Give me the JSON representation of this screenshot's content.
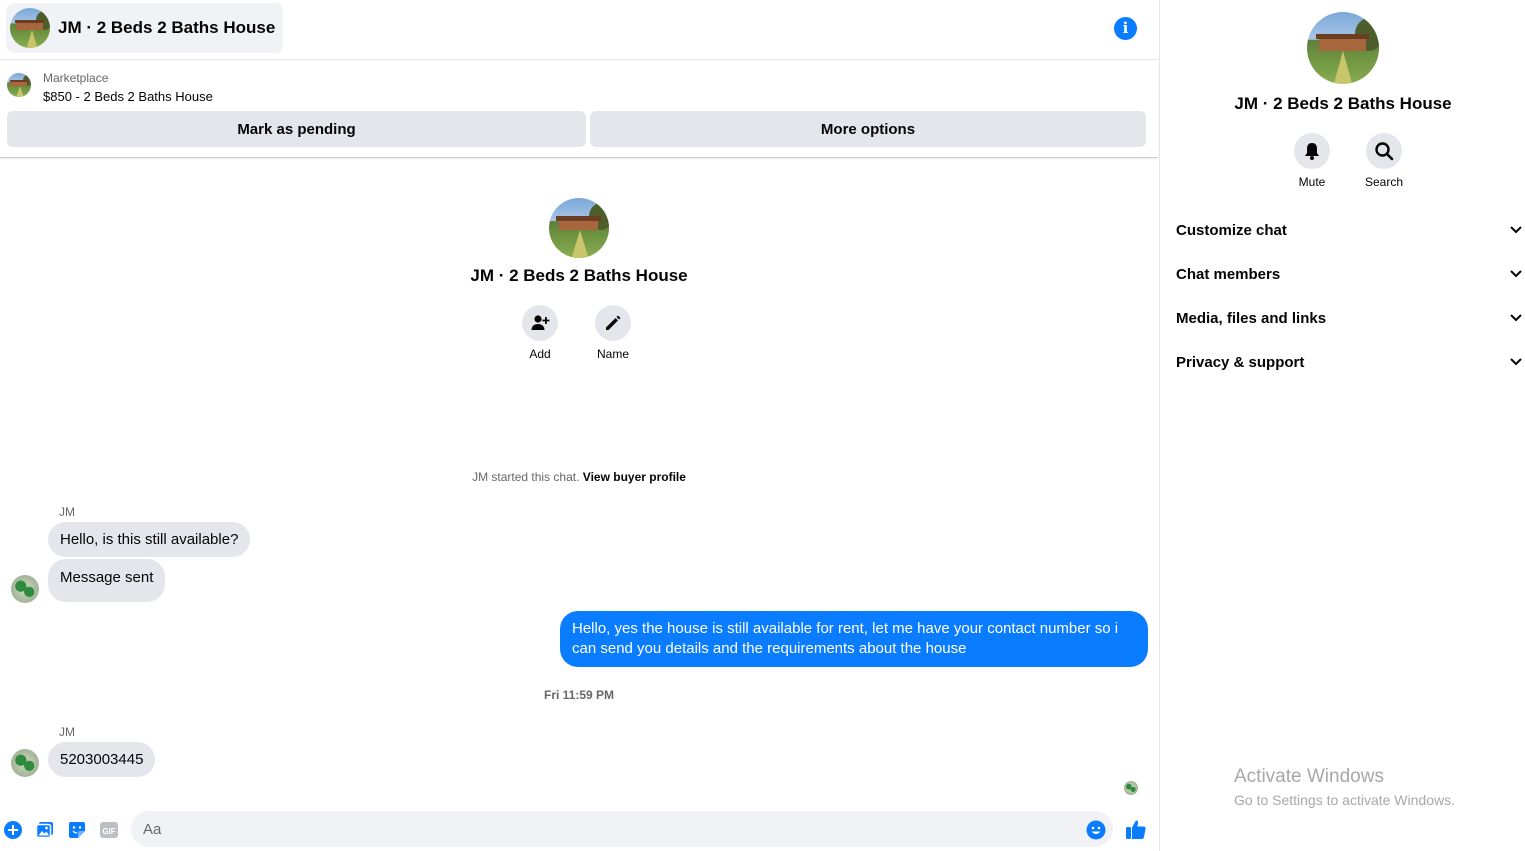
{
  "header": {
    "title": "JM · 2 Beds 2 Baths House"
  },
  "marketplace": {
    "label": "Marketplace",
    "listing": "$850 - 2 Beds 2 Baths House",
    "mark_pending": "Mark as pending",
    "more_options": "More options"
  },
  "chat_intro": {
    "name": "JM · 2 Beds 2 Baths House",
    "add_label": "Add",
    "name_label": "Name",
    "started_text": "JM started this chat.",
    "view_profile": "View buyer profile"
  },
  "messages": [
    {
      "sender": "JM",
      "text": "Hello, is this still available?",
      "direction": "in"
    },
    {
      "text": "Message sent",
      "direction": "in"
    },
    {
      "text": "Hello, yes the house is still available for rent, let me have your contact number so i can send you details and the requirements about the house",
      "direction": "out"
    },
    {
      "sender": "JM",
      "text": "5203003445",
      "direction": "in"
    }
  ],
  "timestamp": "Fri 11:59 PM",
  "composer": {
    "placeholder": "Aa"
  },
  "side_panel": {
    "name": "JM · 2 Beds 2 Baths House",
    "mute_label": "Mute",
    "search_label": "Search",
    "sections": [
      "Customize chat",
      "Chat members",
      "Media, files and links",
      "Privacy & support"
    ]
  },
  "watermark": {
    "title": "Activate Windows",
    "subtitle": "Go to Settings to activate Windows."
  },
  "colors": {
    "accent": "#0a7cff",
    "bubble_in": "#e4e6eb",
    "muted_text": "#65676b"
  },
  "icons": [
    "info-icon",
    "add-person-icon",
    "pencil-icon",
    "bell-icon",
    "search-icon",
    "chevron-down-icon",
    "plus-circle-icon",
    "image-icon",
    "sticker-icon",
    "gif-icon",
    "emoji-icon",
    "thumbs-up-icon"
  ]
}
